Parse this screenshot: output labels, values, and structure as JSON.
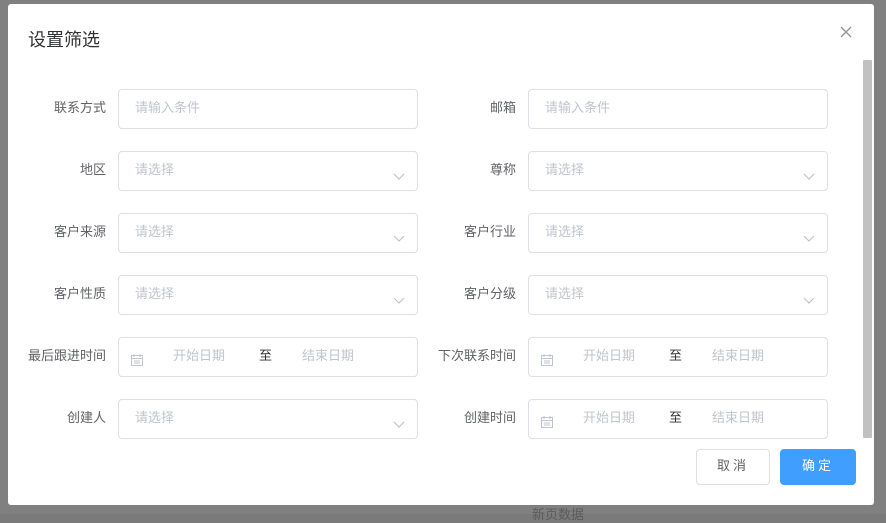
{
  "backdrop": {
    "peek_text": "新页数据"
  },
  "dialog": {
    "title": "设置筛选",
    "rows": [
      {
        "left": {
          "label": "联系方式",
          "placeholder": "请输入条件"
        },
        "right": {
          "label": "邮箱",
          "placeholder": "请输入条件"
        }
      },
      {
        "left": {
          "label": "地区",
          "placeholder": "请选择"
        },
        "right": {
          "label": "尊称",
          "placeholder": "请选择"
        }
      },
      {
        "left": {
          "label": "客户来源",
          "placeholder": "请选择"
        },
        "right": {
          "label": "客户行业",
          "placeholder": "请选择"
        }
      },
      {
        "left": {
          "label": "客户性质",
          "placeholder": "请选择"
        },
        "right": {
          "label": "客户分级",
          "placeholder": "请选择"
        }
      },
      {
        "left": {
          "label": "最后跟进时间",
          "start": "开始日期",
          "sep": "至",
          "end": "结束日期"
        },
        "right": {
          "label": "下次联系时间",
          "start": "开始日期",
          "sep": "至",
          "end": "结束日期"
        }
      },
      {
        "left": {
          "label": "创建人",
          "placeholder": "请选择"
        },
        "right": {
          "label": "创建时间",
          "start": "开始日期",
          "sep": "至",
          "end": "结束日期"
        }
      }
    ],
    "buttons": {
      "cancel": "取消",
      "confirm": "确定"
    }
  },
  "colors": {
    "primary": "#409eff",
    "border": "#dcdfe6",
    "placeholder": "#c0c4cc",
    "label": "#606266",
    "title": "#303133"
  },
  "icons": {
    "close": "close-icon",
    "select_arrow": "chevron-down-icon",
    "date": "calendar-icon"
  }
}
